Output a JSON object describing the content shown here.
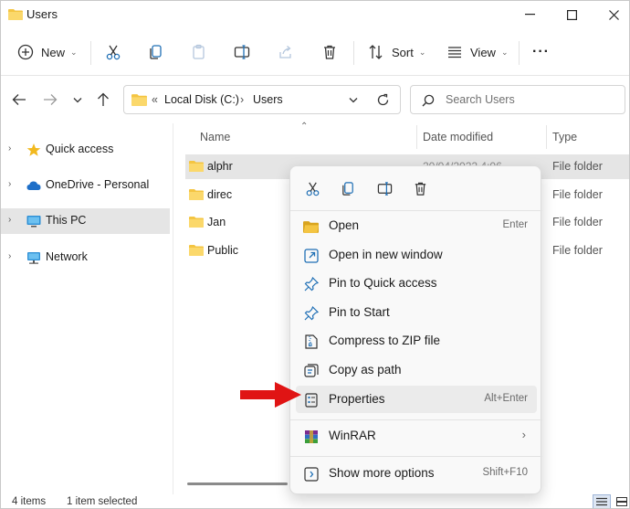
{
  "window": {
    "title": "Users",
    "controls": {
      "minimize": "—",
      "maximize": "☐",
      "close": "✕"
    }
  },
  "toolbar": {
    "new_label": "New",
    "sort_label": "Sort",
    "view_label": "View",
    "more_label": "···"
  },
  "address": {
    "overflow": "«",
    "crumbs": [
      "Local Disk (C:)",
      "Users"
    ],
    "separator": "›"
  },
  "search": {
    "placeholder": "Search Users"
  },
  "nav": {
    "items": [
      {
        "label": "Quick access",
        "icon": "star-icon"
      },
      {
        "label": "OneDrive - Personal",
        "icon": "cloud-icon"
      },
      {
        "label": "This PC",
        "icon": "monitor-icon",
        "selected": true
      },
      {
        "label": "Network",
        "icon": "network-icon"
      }
    ]
  },
  "columns": {
    "name": "Name",
    "date": "Date modified",
    "type": "Type"
  },
  "files": [
    {
      "name": "alphr",
      "date": "20/04/2022 4:06",
      "type": "File folder",
      "selected": true
    },
    {
      "name": "direc",
      "date": "",
      "type": "File folder"
    },
    {
      "name": "Jan",
      "date": "",
      "type": "File folder"
    },
    {
      "name": "Public",
      "date": "",
      "type": "File folder"
    }
  ],
  "status": {
    "count": "4 items",
    "selected": "1 item selected"
  },
  "context_menu": {
    "items": [
      {
        "label": "Open",
        "shortcut": "Enter",
        "icon": "folder-open-icon"
      },
      {
        "label": "Open in new window",
        "shortcut": "",
        "icon": "open-new-window-icon"
      },
      {
        "label": "Pin to Quick access",
        "shortcut": "",
        "icon": "pin-quick-access-icon"
      },
      {
        "label": "Pin to Start",
        "shortcut": "",
        "icon": "pin-start-icon"
      },
      {
        "label": "Compress to ZIP file",
        "shortcut": "",
        "icon": "zip-icon"
      },
      {
        "label": "Copy as path",
        "shortcut": "",
        "icon": "copy-path-icon"
      },
      {
        "label": "Properties",
        "shortcut": "Alt+Enter",
        "icon": "properties-icon",
        "highlighted": true
      },
      {
        "label": "WinRAR",
        "shortcut": "",
        "icon": "winrar-icon",
        "submenu": true
      },
      {
        "label": "Show more options",
        "shortcut": "Shift+F10",
        "icon": "show-more-options-icon"
      }
    ],
    "submenu_arrow": "›"
  },
  "colors": {
    "folder": "#f4c542",
    "selection": "#e5e5e5",
    "accent": "#0067c0",
    "annotation_arrow": "#e01414"
  }
}
